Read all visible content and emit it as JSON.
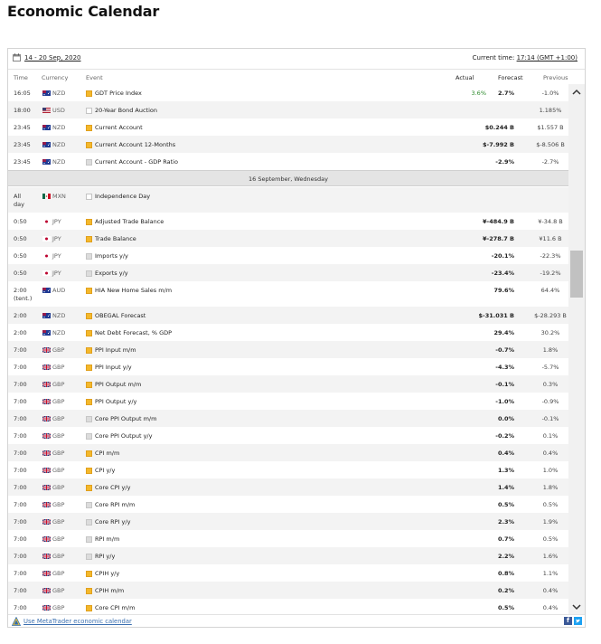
{
  "page": {
    "title": "Economic Calendar"
  },
  "toolbar": {
    "date_range": "14 - 20 Sep, 2020",
    "current_time_label": "Current time:",
    "current_time_value": "17:14 (GMT +1:00)"
  },
  "columns": {
    "time": "Time",
    "currency": "Currency",
    "event": "Event",
    "actual": "Actual",
    "forecast": "Forecast",
    "previous": "Previous"
  },
  "day_separator": "16 September, Wednesday",
  "rows": [
    {
      "time": "16:05",
      "flag": "au",
      "currency": "NZD",
      "importance": "high",
      "event": "GDT Price Index",
      "actual": "3.6%",
      "forecast": "2.7%",
      "previous": "-1.0%"
    },
    {
      "time": "18:00",
      "flag": "us",
      "currency": "USD",
      "importance": "none",
      "event": "20-Year Bond Auction",
      "actual": "",
      "forecast": "",
      "previous": "1.185%"
    },
    {
      "time": "23:45",
      "flag": "au",
      "currency": "NZD",
      "importance": "high",
      "event": "Current Account",
      "actual": "",
      "forecast": "$0.244 B",
      "previous": "$1.557 B"
    },
    {
      "time": "23:45",
      "flag": "au",
      "currency": "NZD",
      "importance": "high",
      "event": "Current Account 12-Months",
      "actual": "",
      "forecast": "$-7.992 B",
      "previous": "$-8.506 B"
    },
    {
      "time": "23:45",
      "flag": "au",
      "currency": "NZD",
      "importance": "low",
      "event": "Current Account - GDP Ratio",
      "actual": "",
      "forecast": "-2.9%",
      "previous": "-2.7%"
    },
    {
      "time": "All day",
      "flag": "mx",
      "currency": "MXN",
      "importance": "none",
      "event": "Independence Day",
      "actual": "",
      "forecast": "",
      "previous": ""
    },
    {
      "time": "0:50",
      "flag": "jp",
      "currency": "JPY",
      "importance": "high",
      "event": "Adjusted Trade Balance",
      "actual": "",
      "forecast": "¥-484.9 B",
      "previous": "¥-34.8 B"
    },
    {
      "time": "0:50",
      "flag": "jp",
      "currency": "JPY",
      "importance": "high",
      "event": "Trade Balance",
      "actual": "",
      "forecast": "¥-278.7 B",
      "previous": "¥11.6 B"
    },
    {
      "time": "0:50",
      "flag": "jp",
      "currency": "JPY",
      "importance": "low",
      "event": "Imports y/y",
      "actual": "",
      "forecast": "-20.1%",
      "previous": "-22.3%"
    },
    {
      "time": "0:50",
      "flag": "jp",
      "currency": "JPY",
      "importance": "low",
      "event": "Exports y/y",
      "actual": "",
      "forecast": "-23.4%",
      "previous": "-19.2%"
    },
    {
      "time": "2:00 (tent.)",
      "flag": "au",
      "currency": "AUD",
      "importance": "high",
      "event": "HIA New Home Sales m/m",
      "actual": "",
      "forecast": "79.6%",
      "previous": "64.4%"
    },
    {
      "time": "2:00",
      "flag": "au",
      "currency": "NZD",
      "importance": "high",
      "event": "OBEGAL Forecast",
      "actual": "",
      "forecast": "$-31.031 B",
      "previous": "$-28.293 B"
    },
    {
      "time": "2:00",
      "flag": "au",
      "currency": "NZD",
      "importance": "high",
      "event": "Net Debt Forecast, % GDP",
      "actual": "",
      "forecast": "29.4%",
      "previous": "30.2%"
    },
    {
      "time": "7:00",
      "flag": "gb",
      "currency": "GBP",
      "importance": "high",
      "event": "PPI Input m/m",
      "actual": "",
      "forecast": "-0.7%",
      "previous": "1.8%"
    },
    {
      "time": "7:00",
      "flag": "gb",
      "currency": "GBP",
      "importance": "high",
      "event": "PPI Input y/y",
      "actual": "",
      "forecast": "-4.3%",
      "previous": "-5.7%"
    },
    {
      "time": "7:00",
      "flag": "gb",
      "currency": "GBP",
      "importance": "high",
      "event": "PPI Output m/m",
      "actual": "",
      "forecast": "-0.1%",
      "previous": "0.3%"
    },
    {
      "time": "7:00",
      "flag": "gb",
      "currency": "GBP",
      "importance": "high",
      "event": "PPI Output y/y",
      "actual": "",
      "forecast": "-1.0%",
      "previous": "-0.9%"
    },
    {
      "time": "7:00",
      "flag": "gb",
      "currency": "GBP",
      "importance": "low",
      "event": "Core PPI Output m/m",
      "actual": "",
      "forecast": "0.0%",
      "previous": "-0.1%"
    },
    {
      "time": "7:00",
      "flag": "gb",
      "currency": "GBP",
      "importance": "low",
      "event": "Core PPI Output y/y",
      "actual": "",
      "forecast": "-0.2%",
      "previous": "0.1%"
    },
    {
      "time": "7:00",
      "flag": "gb",
      "currency": "GBP",
      "importance": "high",
      "event": "CPI m/m",
      "actual": "",
      "forecast": "0.4%",
      "previous": "0.4%"
    },
    {
      "time": "7:00",
      "flag": "gb",
      "currency": "GBP",
      "importance": "high",
      "event": "CPI y/y",
      "actual": "",
      "forecast": "1.3%",
      "previous": "1.0%"
    },
    {
      "time": "7:00",
      "flag": "gb",
      "currency": "GBP",
      "importance": "high",
      "event": "Core CPI y/y",
      "actual": "",
      "forecast": "1.4%",
      "previous": "1.8%"
    },
    {
      "time": "7:00",
      "flag": "gb",
      "currency": "GBP",
      "importance": "low",
      "event": "Core RPI m/m",
      "actual": "",
      "forecast": "0.5%",
      "previous": "0.5%"
    },
    {
      "time": "7:00",
      "flag": "gb",
      "currency": "GBP",
      "importance": "low",
      "event": "Core RPI y/y",
      "actual": "",
      "forecast": "2.3%",
      "previous": "1.9%"
    },
    {
      "time": "7:00",
      "flag": "gb",
      "currency": "GBP",
      "importance": "low",
      "event": "RPI m/m",
      "actual": "",
      "forecast": "0.7%",
      "previous": "0.5%"
    },
    {
      "time": "7:00",
      "flag": "gb",
      "currency": "GBP",
      "importance": "low",
      "event": "RPI y/y",
      "actual": "",
      "forecast": "2.2%",
      "previous": "1.6%"
    },
    {
      "time": "7:00",
      "flag": "gb",
      "currency": "GBP",
      "importance": "high",
      "event": "CPIH y/y",
      "actual": "",
      "forecast": "0.8%",
      "previous": "1.1%"
    },
    {
      "time": "7:00",
      "flag": "gb",
      "currency": "GBP",
      "importance": "high",
      "event": "CPIH m/m",
      "actual": "",
      "forecast": "0.2%",
      "previous": "0.4%"
    },
    {
      "time": "7:00",
      "flag": "gb",
      "currency": "GBP",
      "importance": "high",
      "event": "Core CPI m/m",
      "actual": "",
      "forecast": "0.5%",
      "previous": "0.4%"
    }
  ],
  "footer": {
    "link": "Use MetaTrader economic calendar",
    "facebook_icon": "facebook-icon",
    "twitter_icon": "twitter-icon"
  },
  "colors": {
    "high_importance": "#f4b82b",
    "low_importance": "#dcdcdc",
    "actual_positive": "#2e8b2e",
    "link": "#3a6fb0"
  }
}
